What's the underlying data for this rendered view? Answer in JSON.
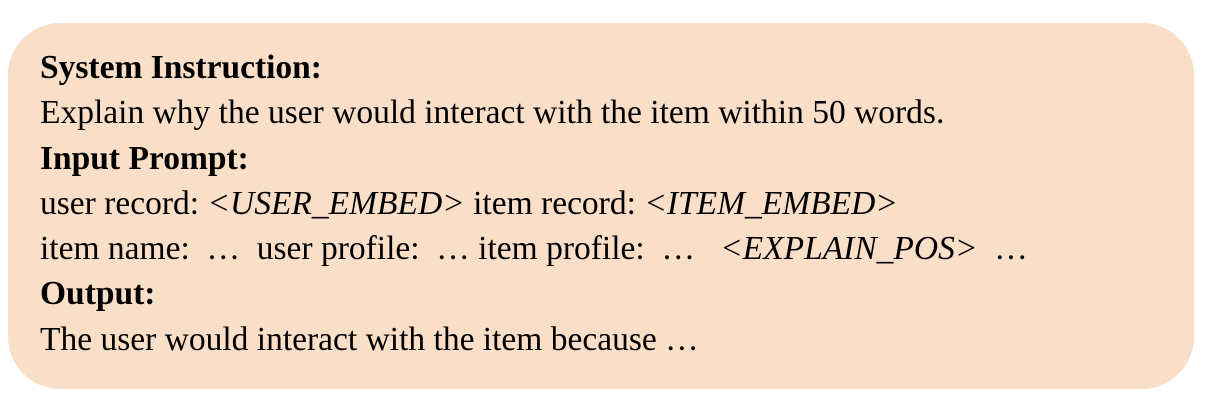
{
  "box_color": "#f9dec8",
  "system_instruction": {
    "heading": "System Instruction:",
    "text": "Explain why the user would interact with the item within 50 words."
  },
  "input_prompt": {
    "heading": "Input Prompt:",
    "line1": {
      "user_record_label": "user record: ",
      "user_embed_token": "<USER_EMBED>",
      "item_record_label": " item record: ",
      "item_embed_token": "<ITEM_EMBED>"
    },
    "line2": {
      "prefix": "item name:  …  user profile:  … item profile:  …   ",
      "explain_pos_token": "<EXPLAIN_POS>",
      "suffix": "  …"
    }
  },
  "output": {
    "heading": "Output:",
    "text": "The user would interact with the item because …"
  }
}
